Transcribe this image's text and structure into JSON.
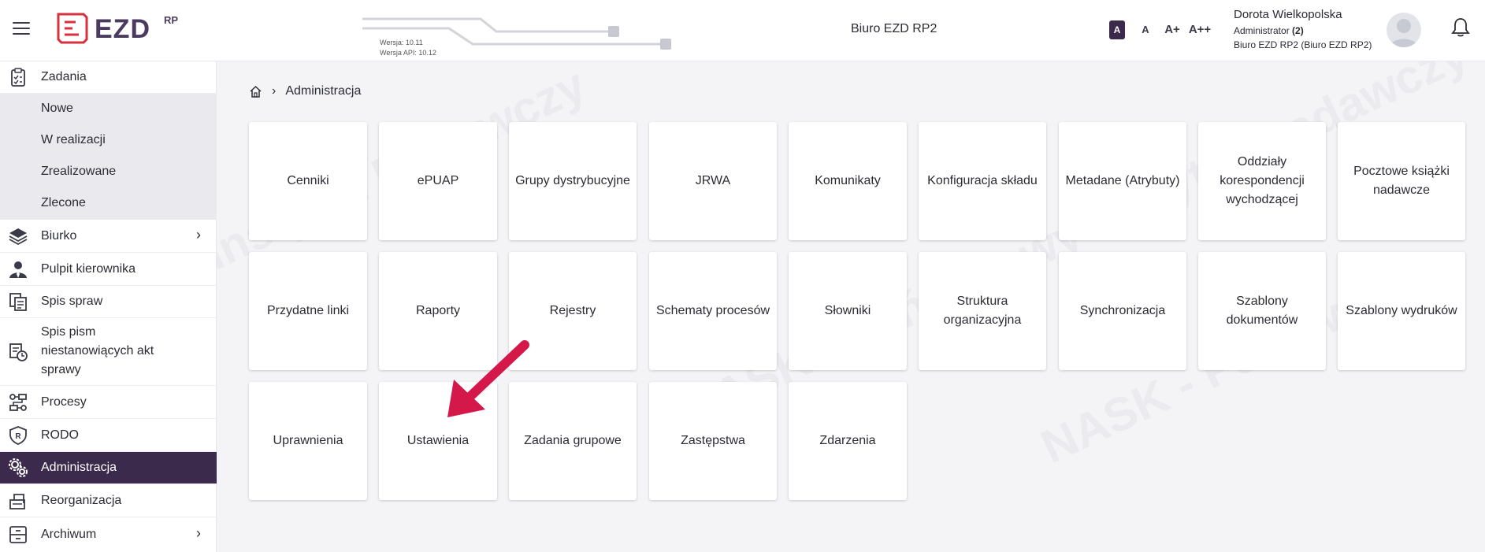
{
  "header": {
    "logo_text": "EZD",
    "logo_sup": "RP",
    "version": "Wersja: 10.11",
    "api_version": "Wersja API: 10.12",
    "app_title": "Biuro EZD RP2",
    "font_sizes": [
      "A",
      "A",
      "A+",
      "A++"
    ],
    "user": {
      "name": "Dorota Wielkopolska",
      "role": "Administrator",
      "role_count": "(2)",
      "unit": "Biuro EZD RP2 (Biuro EZD RP2)"
    }
  },
  "sidebar": {
    "items": [
      {
        "label": "Zadania",
        "icon": "clipboard-icon"
      },
      {
        "label": "Nowe"
      },
      {
        "label": "W realizacji"
      },
      {
        "label": "Zrealizowane"
      },
      {
        "label": "Zlecone"
      },
      {
        "label": "Biurko",
        "icon": "layers-icon",
        "chevron": "›"
      },
      {
        "label": "Pulpit kierownika",
        "icon": "manager-icon"
      },
      {
        "label": "Spis spraw",
        "icon": "files-icon"
      },
      {
        "label": "Spis pism niestanowiących akt sprawy",
        "icon": "documents-icon"
      },
      {
        "label": "Procesy",
        "icon": "process-icon"
      },
      {
        "label": "RODO",
        "icon": "shield-icon"
      },
      {
        "label": "Administracja",
        "icon": "gears-icon"
      },
      {
        "label": "Reorganizacja",
        "icon": "reorganize-icon"
      },
      {
        "label": "Archiwum",
        "icon": "archive-icon",
        "chevron": "›"
      }
    ]
  },
  "breadcrumb": {
    "separator": "›",
    "current": "Administracja"
  },
  "tiles": [
    "Cenniki",
    "ePUAP",
    "Grupy dystrybucyjne",
    "JRWA",
    "Komunikaty",
    "Konfiguracja składu",
    "Metadane (Atrybuty)",
    "Oddziały korespondencji wychodzącej",
    "Pocztowe książki nadawcze",
    "Przydatne linki",
    "Raporty",
    "Rejestry",
    "Schematy procesów",
    "Słowniki",
    "Struktura organizacyjna",
    "Synchronizacja",
    "Szablony dokumentów",
    "Szablony wydruków",
    "Uprawnienia",
    "Ustawienia",
    "Zadania grupowe",
    "Zastępstwa",
    "Zdarzenia"
  ],
  "colors": {
    "accent": "#3c2a4d",
    "arrow": "#d4184a",
    "logo_red": "#d6313c"
  }
}
